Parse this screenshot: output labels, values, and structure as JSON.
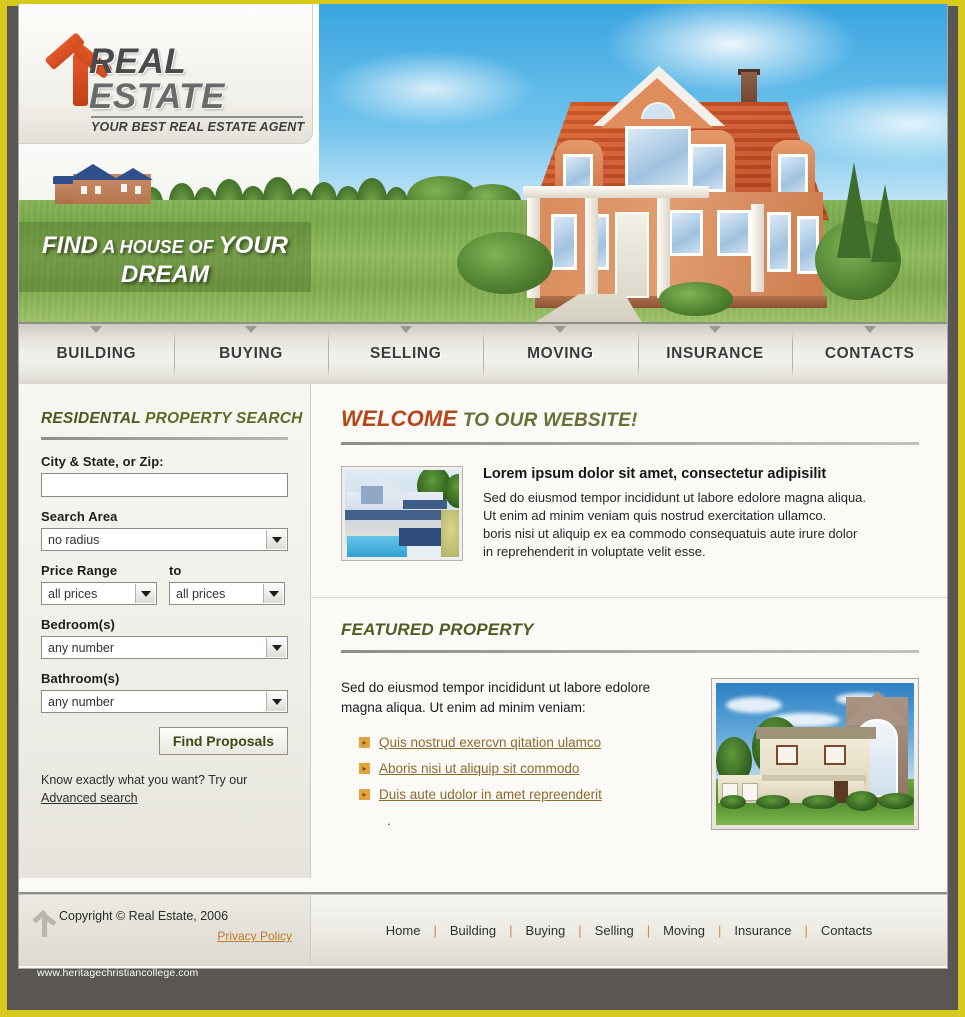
{
  "brand": {
    "title_bold": "REAL",
    "title_light": " ESTATE",
    "tagline": "YOUR BEST REAL ESTATE AGENT"
  },
  "hero": {
    "slogan_line1_a": "FIND",
    "slogan_line1_b": " A HOUSE OF ",
    "slogan_line1_c": "YOUR",
    "slogan_line2": "DREAM"
  },
  "nav": {
    "items": [
      {
        "label": "BUILDING"
      },
      {
        "label": "BUYING"
      },
      {
        "label": "SELLING"
      },
      {
        "label": "MOVING"
      },
      {
        "label": "INSURANCE"
      },
      {
        "label": "CONTACTS"
      }
    ]
  },
  "sidebar": {
    "heading_a": "RESIDENTAL",
    "heading_b": " PROPERTY SEARCH",
    "city_label": "City & State, or Zip:",
    "city_value": "",
    "city_placeholder": "",
    "area_label": "Search Area",
    "area_value": "no radius",
    "price_label": "Price Range",
    "price_to_label": "to",
    "price_from_value": "all prices",
    "price_to_value": "all prices",
    "bedrooms_label": "Bedroom(s)",
    "bedrooms_value": "any number",
    "bathrooms_label": "Bathroom(s)",
    "bathrooms_value": "any number",
    "find_button": "Find Proposals",
    "hint_text": "Know exactly what you want? Try our",
    "advanced_link": "Advanced search"
  },
  "welcome": {
    "title_a": "WELCOME",
    "title_b": " TO OUR WEBSITE!",
    "article_heading": "Lorem ipsum dolor sit amet, consectetur adipisilit",
    "article_line1": "Sed do eiusmod tempor incididunt ut labore edolore magna aliqua.",
    "article_line2": "Ut enim ad minim veniam quis nostrud exercitation ullamco.",
    "article_line3": "boris nisi ut aliquip ex ea commodo consequatuis aute irure dolor",
    "article_line4": "in reprehenderit in voluptate velit esse."
  },
  "featured": {
    "title": "FEATURED PROPERTY",
    "intro_line1": "Sed do eiusmod tempor incididunt ut labore edolore",
    "intro_line2": "magna aliqua. Ut enim ad minim veniam:",
    "links": [
      {
        "label": "Quis nostrud exercvn qitation ulamco"
      },
      {
        "label": "Aboris nisi ut aliquip sit commodo"
      },
      {
        "label": "Duis aute udolor in amet repreenderit"
      }
    ],
    "trailing_dot": "."
  },
  "footer": {
    "copyright": "Copyright © Real Estate, 2006",
    "privacy_label": "Privacy Policy",
    "links": [
      {
        "label": "Home"
      },
      {
        "label": "Building"
      },
      {
        "label": "Buying"
      },
      {
        "label": "Selling"
      },
      {
        "label": "Moving"
      },
      {
        "label": "Insurance"
      },
      {
        "label": "Contacts"
      }
    ],
    "separator": "|"
  },
  "watermark": {
    "url": "www.heritagechristiancollege.com"
  },
  "colors": {
    "frame": "#d8c91f",
    "page_bg": "#5a5653",
    "accent_orange": "#b8461b",
    "accent_olive": "#4f5c24",
    "link_gold": "#8d6a2c",
    "bullet": "#e2a43c"
  }
}
